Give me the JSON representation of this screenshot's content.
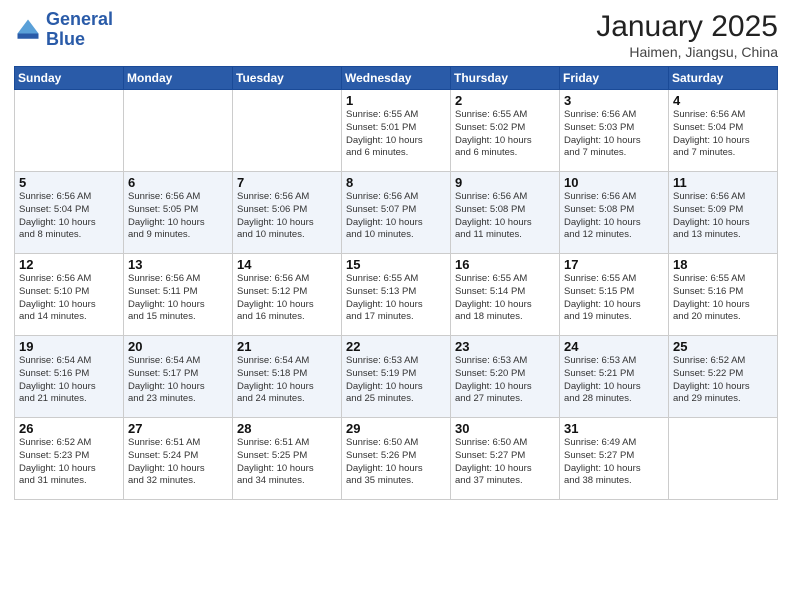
{
  "header": {
    "logo": {
      "line1": "General",
      "line2": "Blue"
    },
    "title": "January 2025",
    "subtitle": "Haimen, Jiangsu, China"
  },
  "days_of_week": [
    "Sunday",
    "Monday",
    "Tuesday",
    "Wednesday",
    "Thursday",
    "Friday",
    "Saturday"
  ],
  "weeks": [
    [
      {
        "day": "",
        "info": ""
      },
      {
        "day": "",
        "info": ""
      },
      {
        "day": "",
        "info": ""
      },
      {
        "day": "1",
        "info": "Sunrise: 6:55 AM\nSunset: 5:01 PM\nDaylight: 10 hours\nand 6 minutes."
      },
      {
        "day": "2",
        "info": "Sunrise: 6:55 AM\nSunset: 5:02 PM\nDaylight: 10 hours\nand 6 minutes."
      },
      {
        "day": "3",
        "info": "Sunrise: 6:56 AM\nSunset: 5:03 PM\nDaylight: 10 hours\nand 7 minutes."
      },
      {
        "day": "4",
        "info": "Sunrise: 6:56 AM\nSunset: 5:04 PM\nDaylight: 10 hours\nand 7 minutes."
      }
    ],
    [
      {
        "day": "5",
        "info": "Sunrise: 6:56 AM\nSunset: 5:04 PM\nDaylight: 10 hours\nand 8 minutes."
      },
      {
        "day": "6",
        "info": "Sunrise: 6:56 AM\nSunset: 5:05 PM\nDaylight: 10 hours\nand 9 minutes."
      },
      {
        "day": "7",
        "info": "Sunrise: 6:56 AM\nSunset: 5:06 PM\nDaylight: 10 hours\nand 10 minutes."
      },
      {
        "day": "8",
        "info": "Sunrise: 6:56 AM\nSunset: 5:07 PM\nDaylight: 10 hours\nand 10 minutes."
      },
      {
        "day": "9",
        "info": "Sunrise: 6:56 AM\nSunset: 5:08 PM\nDaylight: 10 hours\nand 11 minutes."
      },
      {
        "day": "10",
        "info": "Sunrise: 6:56 AM\nSunset: 5:08 PM\nDaylight: 10 hours\nand 12 minutes."
      },
      {
        "day": "11",
        "info": "Sunrise: 6:56 AM\nSunset: 5:09 PM\nDaylight: 10 hours\nand 13 minutes."
      }
    ],
    [
      {
        "day": "12",
        "info": "Sunrise: 6:56 AM\nSunset: 5:10 PM\nDaylight: 10 hours\nand 14 minutes."
      },
      {
        "day": "13",
        "info": "Sunrise: 6:56 AM\nSunset: 5:11 PM\nDaylight: 10 hours\nand 15 minutes."
      },
      {
        "day": "14",
        "info": "Sunrise: 6:56 AM\nSunset: 5:12 PM\nDaylight: 10 hours\nand 16 minutes."
      },
      {
        "day": "15",
        "info": "Sunrise: 6:55 AM\nSunset: 5:13 PM\nDaylight: 10 hours\nand 17 minutes."
      },
      {
        "day": "16",
        "info": "Sunrise: 6:55 AM\nSunset: 5:14 PM\nDaylight: 10 hours\nand 18 minutes."
      },
      {
        "day": "17",
        "info": "Sunrise: 6:55 AM\nSunset: 5:15 PM\nDaylight: 10 hours\nand 19 minutes."
      },
      {
        "day": "18",
        "info": "Sunrise: 6:55 AM\nSunset: 5:16 PM\nDaylight: 10 hours\nand 20 minutes."
      }
    ],
    [
      {
        "day": "19",
        "info": "Sunrise: 6:54 AM\nSunset: 5:16 PM\nDaylight: 10 hours\nand 21 minutes."
      },
      {
        "day": "20",
        "info": "Sunrise: 6:54 AM\nSunset: 5:17 PM\nDaylight: 10 hours\nand 23 minutes."
      },
      {
        "day": "21",
        "info": "Sunrise: 6:54 AM\nSunset: 5:18 PM\nDaylight: 10 hours\nand 24 minutes."
      },
      {
        "day": "22",
        "info": "Sunrise: 6:53 AM\nSunset: 5:19 PM\nDaylight: 10 hours\nand 25 minutes."
      },
      {
        "day": "23",
        "info": "Sunrise: 6:53 AM\nSunset: 5:20 PM\nDaylight: 10 hours\nand 27 minutes."
      },
      {
        "day": "24",
        "info": "Sunrise: 6:53 AM\nSunset: 5:21 PM\nDaylight: 10 hours\nand 28 minutes."
      },
      {
        "day": "25",
        "info": "Sunrise: 6:52 AM\nSunset: 5:22 PM\nDaylight: 10 hours\nand 29 minutes."
      }
    ],
    [
      {
        "day": "26",
        "info": "Sunrise: 6:52 AM\nSunset: 5:23 PM\nDaylight: 10 hours\nand 31 minutes."
      },
      {
        "day": "27",
        "info": "Sunrise: 6:51 AM\nSunset: 5:24 PM\nDaylight: 10 hours\nand 32 minutes."
      },
      {
        "day": "28",
        "info": "Sunrise: 6:51 AM\nSunset: 5:25 PM\nDaylight: 10 hours\nand 34 minutes."
      },
      {
        "day": "29",
        "info": "Sunrise: 6:50 AM\nSunset: 5:26 PM\nDaylight: 10 hours\nand 35 minutes."
      },
      {
        "day": "30",
        "info": "Sunrise: 6:50 AM\nSunset: 5:27 PM\nDaylight: 10 hours\nand 37 minutes."
      },
      {
        "day": "31",
        "info": "Sunrise: 6:49 AM\nSunset: 5:27 PM\nDaylight: 10 hours\nand 38 minutes."
      },
      {
        "day": "",
        "info": ""
      }
    ]
  ],
  "shaded_rows": [
    1,
    3
  ]
}
